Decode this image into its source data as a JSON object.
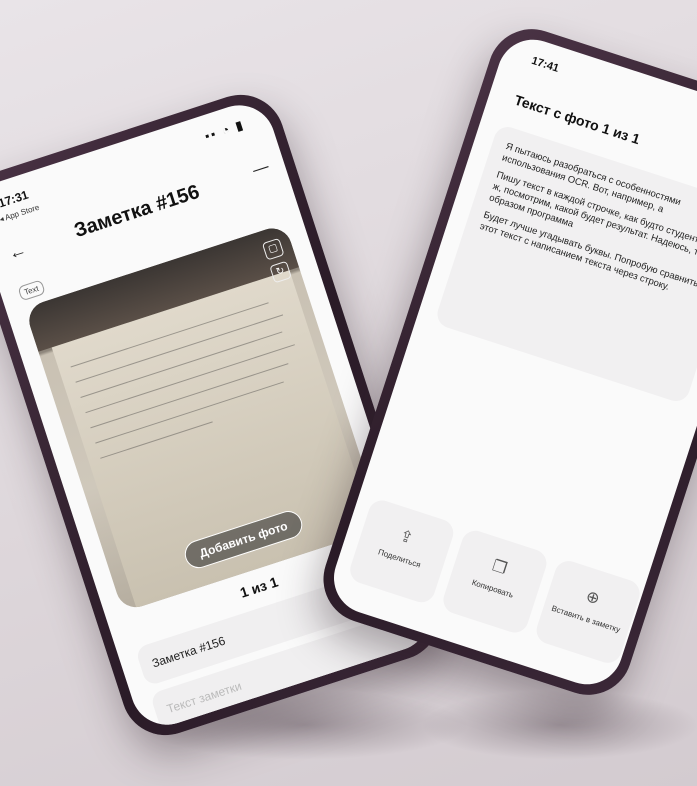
{
  "left_phone": {
    "status_time": "17:31",
    "status_icons": "▪▪ ◔ ▮",
    "back_store": "◂ App Store",
    "title": "Заметка #156",
    "text_chip": "Text",
    "add_photo": "Добавить фото",
    "counter": "1 из 1",
    "note_name": "Заметка #156",
    "note_text_placeholder": "Текст заметки"
  },
  "right_phone": {
    "status_time": "17:41",
    "title": "Текст с фото 1 из 1",
    "paragraphs": [
      "Я пытаюсь разобраться с особенностями использования OCR. Вот, например, а",
      "Пишу текст в каждой строчке, как будто студент. Что ж, посмотрим, какой будет результат. Надеюсь, такие образом программа",
      "Будет лучше угадывать буквы. Попробую сравнить этот текст с написанием текста через строку."
    ],
    "actions": [
      {
        "label": "Поделиться",
        "icon": "share-icon"
      },
      {
        "label": "Копировать",
        "icon": "copy-icon"
      },
      {
        "label": "Вставить в заметку",
        "icon": "paste-icon"
      }
    ]
  }
}
